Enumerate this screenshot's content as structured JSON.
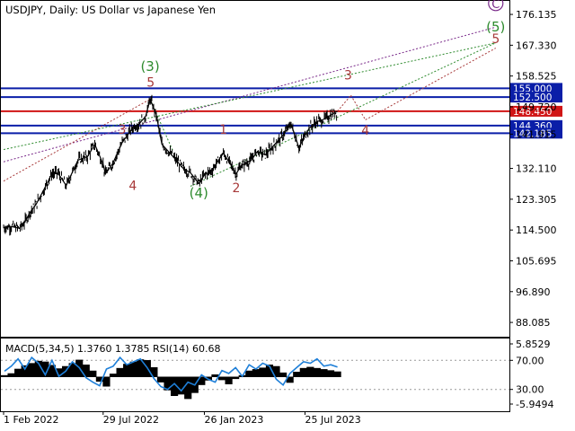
{
  "header": {
    "title": "USDJPY, Daily:  US Dollar vs Japanese Yen",
    "indicator": "MACD(5,34,5) 1.3760 1.3785 RSI(14) 60.68"
  },
  "colors": {
    "price": "#000000",
    "level_blue": "#0a1ea8",
    "level_red": "#d01515",
    "wave_green": "#2e8b2e",
    "wave_red": "#a83a3a",
    "wave_purple": "#7a2a8a",
    "label_bg_blue": "#0a1ea8",
    "label_bg_red": "#d01515",
    "rsi_line": "#1e7fd8"
  },
  "chart_data": [
    {
      "type": "line",
      "title": "USDJPY, Daily:  US Dollar vs Japanese Yen",
      "series": [
        {
          "name": "USDJPY",
          "points": [
            [
              "1 Feb 2022",
              115.2
            ],
            [
              "15 Feb 2022",
              115.5
            ],
            [
              "1 Mar 2022",
              115.0
            ],
            [
              "10 Mar 2022",
              116.5
            ],
            [
              "20 Mar 2022",
              119.5
            ],
            [
              "31 Mar 2022",
              121.8
            ],
            [
              "15 Apr 2022",
              126.3
            ],
            [
              "28 Apr 2022",
              130.5
            ],
            [
              "9 May 2022",
              130.8
            ],
            [
              "24 May 2022",
              127.2
            ],
            [
              "1 Jun 2022",
              130.0
            ],
            [
              "14 Jun 2022",
              134.5
            ],
            [
              "1 Jul 2022",
              135.5
            ],
            [
              "14 Jul 2022",
              139.0
            ],
            [
              "29 Jul 2022",
              133.3
            ],
            [
              "2 Aug 2022",
              130.5
            ],
            [
              "15 Aug 2022",
              133.5
            ],
            [
              "1 Sep 2022",
              139.5
            ],
            [
              "21 Sep 2022",
              144.0
            ],
            [
              "1 Oct 2022",
              144.8
            ],
            [
              "13 Oct 2022",
              147.0
            ],
            [
              "21 Oct 2022",
              151.9
            ],
            [
              "1 Nov 2022",
              147.5
            ],
            [
              "11 Nov 2022",
              139.0
            ],
            [
              "1 Dec 2022",
              135.5
            ],
            [
              "20 Dec 2022",
              132.0
            ],
            [
              "1 Jan 2023",
              130.9
            ],
            [
              "16 Jan 2023",
              127.8
            ],
            [
              "26 Jan 2023",
              130.2
            ],
            [
              "8 Feb 2023",
              131.5
            ],
            [
              "1 Mar 2023",
              136.5
            ],
            [
              "15 Mar 2023",
              133.0
            ],
            [
              "24 Mar 2023",
              130.5
            ],
            [
              "1 Apr 2023",
              132.8
            ],
            [
              "20 Apr 2023",
              134.5
            ],
            [
              "1 May 2023",
              137.0
            ],
            [
              "15 May 2023",
              136.0
            ],
            [
              "1 Jun 2023",
              139.0
            ],
            [
              "15 Jun 2023",
              141.5
            ],
            [
              "30 Jun 2023",
              144.8
            ],
            [
              "14 Jul 2023",
              138.0
            ],
            [
              "25 Jul 2023",
              141.5
            ],
            [
              "1 Aug 2023",
              143.5
            ],
            [
              "15 Aug 2023",
              145.5
            ],
            [
              "25 Aug 2023",
              146.0
            ],
            [
              "1 Sep 2023",
              146.5
            ],
            [
              "10 Sep 2023",
              147.5
            ],
            [
              "21 Sep 2023",
              148.45
            ]
          ]
        }
      ],
      "levels": [
        {
          "value": 155.0,
          "label": "155.000",
          "color": "blue"
        },
        {
          "value": 152.5,
          "label": "152.500",
          "color": "blue"
        },
        {
          "value": 148.45,
          "label": "148.450",
          "color": "red"
        },
        {
          "value": 144.36,
          "label": "144.360",
          "color": "blue"
        },
        {
          "value": 142.185,
          "label": "142.185",
          "color": "blue"
        }
      ],
      "y_ticks": [
        "176.135",
        "167.330",
        "158.525",
        "149.720",
        "141.915",
        "132.110",
        "123.305",
        "114.500",
        "105.695",
        "96.890",
        "88.085"
      ],
      "x_ticks": [
        "1 Feb 2022",
        "29 Jul 2022",
        "26 Jan 2023",
        "25 Jul 2023"
      ],
      "wave_labels": {
        "green": [
          {
            "text": "(3)",
            "x": "21 Oct 2022",
            "y": 160.0
          },
          {
            "text": "(4)",
            "x": "16 Jan 2023",
            "y": 123.8
          },
          {
            "text": "(5)",
            "x": "30 Jun 2024",
            "y": 171.3
          }
        ],
        "red": [
          {
            "text": "3",
            "x": "1 Sep 2022",
            "y": 142.0
          },
          {
            "text": "4",
            "x": "20 Sep 2022",
            "y": 126.0
          },
          {
            "text": "5",
            "x": "22 Oct 2022",
            "y": 155.5
          },
          {
            "text": "1",
            "x": "1 Mar 2023",
            "y": 142.0
          },
          {
            "text": "2",
            "x": "24 Mar 2023",
            "y": 125.3
          },
          {
            "text": "3",
            "x": "10 Oct 2023",
            "y": 157.5
          },
          {
            "text": "4",
            "x": "10 Nov 2023",
            "y": 141.8
          },
          {
            "text": "5",
            "x": "30 Jun 2024",
            "y": 168.0
          }
        ],
        "purple": [
          {
            "text": "C",
            "x": "30 Jun 2024",
            "y": 178.0
          }
        ]
      },
      "projections": [
        {
          "color": "purple",
          "from": [
            "1 Feb 2022",
            134.0
          ],
          "to": [
            "30 Jun 2024",
            172.5
          ]
        },
        {
          "color": "green",
          "from": [
            "1 Feb 2022",
            137.5
          ],
          "to": [
            "30 Jun 2024",
            168.0
          ]
        },
        {
          "color": "red",
          "from": [
            "1 Feb 2022",
            128.5
          ],
          "to": [
            "21 Oct 2022",
            151.9
          ]
        },
        {
          "color": "green",
          "from": [
            "21 Oct 2022",
            151.9
          ],
          "to": [
            "1 Dec 2022",
            137.0
          ]
        },
        {
          "color": "green",
          "from": [
            "1 Jan 2023",
            127.0
          ],
          "to": [
            "30 Jun 2024",
            168.0
          ]
        },
        {
          "color": "red",
          "from": [
            "21 Sep 2023",
            148.45
          ],
          "to": [
            "15 Oct 2023",
            153.0
          ]
        },
        {
          "color": "red",
          "from": [
            "15 Oct 2023",
            153.0
          ],
          "to": [
            "10 Nov 2023",
            146.0
          ]
        },
        {
          "color": "red",
          "from": [
            "10 Nov 2023",
            146.0
          ],
          "to": [
            "30 Jun 2024",
            166.5
          ]
        }
      ]
    },
    {
      "type": "area",
      "title": "MACD(5,34,5) 1.3760 1.3785 RSI(14) 60.68",
      "y_ticks": [
        "5.8529",
        "70.00",
        "30.00",
        "-5.9494"
      ],
      "levels": [
        70,
        30
      ],
      "series": [
        {
          "name": "MACD",
          "values": [
            0.4,
            0.9,
            2.1,
            3.0,
            3.6,
            4.2,
            4.0,
            3.1,
            2.2,
            2.8,
            3.6,
            4.5,
            3.2,
            1.6,
            -1.2,
            -2.5,
            0.8,
            2.3,
            3.4,
            4.0,
            4.6,
            4.4,
            2.5,
            -1.4,
            -3.5,
            -5.0,
            -4.6,
            -5.8,
            -4.2,
            -2.1,
            -0.9,
            0.6,
            -0.8,
            -1.9,
            -0.5,
            0.4,
            1.6,
            2.0,
            2.4,
            3.2,
            2.8,
            1.1,
            -1.5,
            1.3,
            2.3,
            2.6,
            2.3,
            2.0,
            1.7,
            1.38
          ]
        },
        {
          "name": "RSI(14)",
          "values": [
            55,
            62,
            72,
            58,
            74,
            66,
            50,
            70,
            48,
            55,
            68,
            60,
            46,
            40,
            35,
            58,
            62,
            74,
            64,
            68,
            72,
            60,
            45,
            34,
            30,
            38,
            28,
            40,
            36,
            50,
            44,
            40,
            56,
            52,
            60,
            48,
            64,
            58,
            66,
            62,
            44,
            36,
            52,
            60,
            68,
            66,
            72,
            62,
            64,
            60.68
          ]
        }
      ]
    }
  ]
}
